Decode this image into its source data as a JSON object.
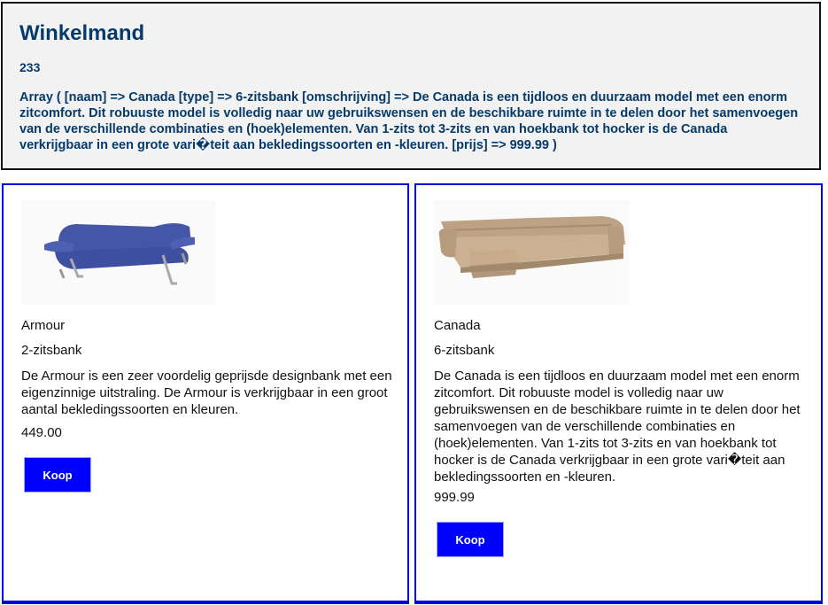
{
  "cart": {
    "title": "Winkelmand",
    "count": "233",
    "dump": "Array ( [naam] => Canada [type] => 6-zitsbank [omschrijving] => De Canada is een tijdloos en duurzaam model met een enorm zitcomfort. Dit robuuste model is volledig naar uw gebruikswensen en de beschikbare ruimte in te delen door het samenvoegen van de verschillende combinaties en (hoek)elementen. Van 1-zits tot 3-zits en van hoekbank tot hocker is de Canada verkrijgbaar in een grote vari�teit aan bekledingssoorten en -kleuren. [prijs] => 999.99 )"
  },
  "products": [
    {
      "name": "Armour",
      "type": "2-zitsbank",
      "description": "De Armour is een zeer voordelig geprijsde designbank met een eigenzinnige uitstraling. De Armour is verkrijgbaar in een groot aantal bekledingssoorten en kleuren.",
      "price": "449.00",
      "buy_label": "Koop",
      "image_icon": "blue-sofa-image"
    },
    {
      "name": "Canada",
      "type": "6-zitsbank",
      "description": "De Canada is een tijdloos en duurzaam model met een enorm zitcomfort. Dit robuuste model is volledig naar uw gebruikswensen en de beschikbare ruimte in te delen door het samenvoegen van de verschillende combinaties en (hoek)elementen. Van 1-zits tot 3-zits en van hoekbank tot hocker is de Canada verkrijgbaar in een grote vari�teit aan bekledingssoorten en -kleuren.",
      "price": "999.99",
      "buy_label": "Koop",
      "image_icon": "beige-corner-sofa-image"
    }
  ],
  "colors": {
    "heading": "#063a6a",
    "card_border": "#0000e0",
    "button": "#0000ff",
    "cart_bg": "#f2f2f2"
  }
}
